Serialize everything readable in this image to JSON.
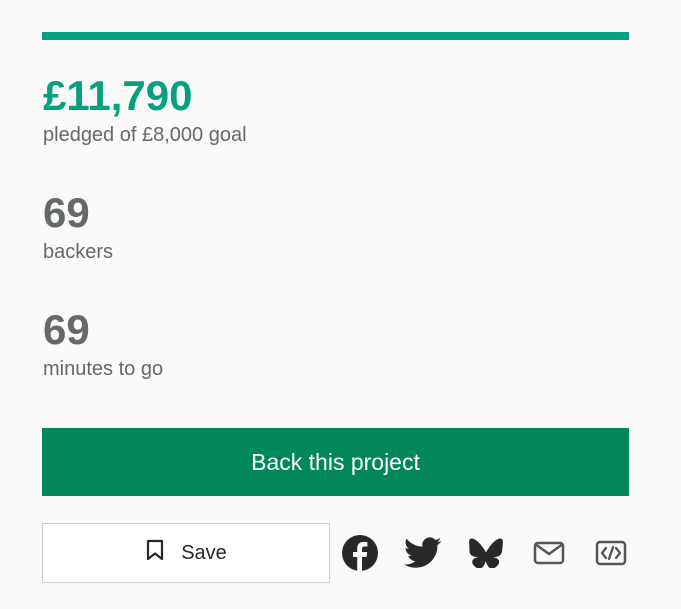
{
  "progress": {
    "fraction": 1.0,
    "color": "#05a081"
  },
  "stats": {
    "pledged_amount": "£11,790",
    "pledged_label": "pledged of £8,000 goal",
    "backers_count": "69",
    "backers_label": "backers",
    "time_count": "69",
    "time_label": "minutes to go"
  },
  "actions": {
    "back_label": "Back this project",
    "save_label": "Save"
  },
  "share_icons": [
    "facebook-icon",
    "twitter-icon",
    "bluesky-icon",
    "email-icon",
    "embed-icon"
  ],
  "colors": {
    "accent": "#05a081",
    "button": "#028858",
    "text_muted": "#656969",
    "icon": "#282828"
  }
}
